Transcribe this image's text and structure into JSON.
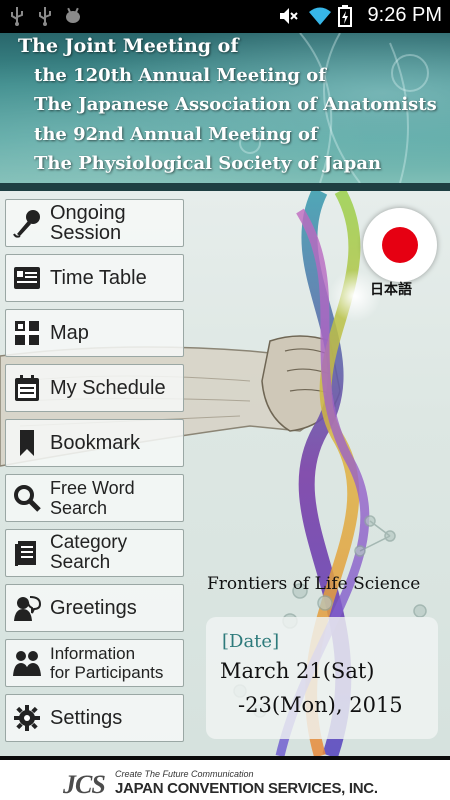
{
  "status_bar": {
    "left_icons": [
      "usb-icon",
      "usb-icon",
      "android-debug-icon"
    ],
    "right_icons": [
      "mute-icon",
      "wifi-icon",
      "battery-charging-icon"
    ],
    "time": "9:26 PM"
  },
  "header": {
    "line1": "The Joint Meeting of",
    "line2": "the 120th Annual Meeting of",
    "line3": "The Japanese Association of Anatomists",
    "line4": "the 92nd Annual Meeting of",
    "line5": "The Physiological Society of Japan"
  },
  "menu": {
    "items": [
      {
        "label": "Ongoing Session",
        "icon": "microphone-icon"
      },
      {
        "label": "Time Table",
        "icon": "timetable-icon"
      },
      {
        "label": "Map",
        "icon": "map-icon"
      },
      {
        "label": "My Schedule",
        "icon": "calendar-icon"
      },
      {
        "label": "Bookmark",
        "icon": "bookmark-icon"
      },
      {
        "label": "Free Word Search",
        "icon": "search-icon"
      },
      {
        "label": "Category Search",
        "icon": "document-icon"
      },
      {
        "label": "Greetings",
        "icon": "greetings-icon"
      },
      {
        "label": "Information\nfor Participants",
        "label_line1": "Information",
        "label_line2": "for Participants",
        "icon": "participants-icon"
      },
      {
        "label": "Settings",
        "icon": "gear-icon"
      }
    ]
  },
  "language": {
    "label": "日本語",
    "flag_color": "#e60012"
  },
  "slogan": "Frontiers of Life Science",
  "date": {
    "label": "[Date]",
    "line1": "March 21(Sat)",
    "line2": "-23(Mon), 2015"
  },
  "footer": {
    "logo": "JCS",
    "tagline": "Create The Future Communication",
    "company": "JAPAN CONVENTION SERVICES, INC."
  },
  "colors": {
    "accent_teal": "#2d7a7b",
    "header_teal": "#3f8e8e",
    "flag_red": "#e60012"
  }
}
